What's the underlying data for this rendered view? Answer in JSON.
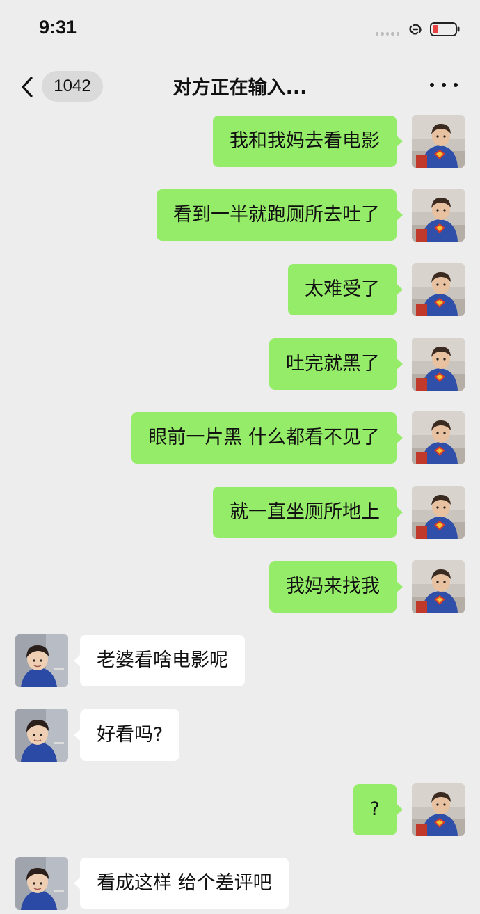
{
  "status_bar": {
    "time": "9:31",
    "icons": [
      "signal-dots-icon",
      "link-icon",
      "battery-low-icon"
    ],
    "battery_color": "#e84343"
  },
  "nav": {
    "back_icon": "chevron-left-icon",
    "unread_count": "1042",
    "title": "对方正在输入...",
    "more_icon": "more-dots-icon"
  },
  "colors": {
    "background": "#ededed",
    "outgoing_bubble": "#95ec69",
    "incoming_bubble": "#ffffff"
  },
  "messages": [
    {
      "side": "out",
      "text": "我和我妈去看电影"
    },
    {
      "side": "out",
      "text": "看到一半就跑厕所去吐了"
    },
    {
      "side": "out",
      "text": "太难受了"
    },
    {
      "side": "out",
      "text": "吐完就黑了"
    },
    {
      "side": "out",
      "text": "眼前一片黑 什么都看不见了"
    },
    {
      "side": "out",
      "text": "就一直坐厕所地上"
    },
    {
      "side": "out",
      "text": "我妈来找我"
    },
    {
      "side": "in",
      "text": "老婆看啥电影呢"
    },
    {
      "side": "in",
      "text": "好看吗?"
    },
    {
      "side": "out",
      "text": "?"
    },
    {
      "side": "in",
      "text": "看成这样 给个差评吧"
    }
  ]
}
